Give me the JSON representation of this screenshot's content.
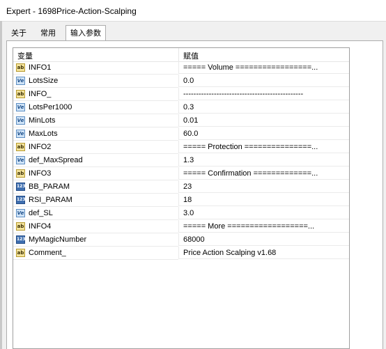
{
  "window": {
    "title": "Expert - 1698Price-Action-Scalping"
  },
  "tabs": [
    {
      "label": "关于"
    },
    {
      "label": "常用"
    },
    {
      "label": "输入参数"
    }
  ],
  "grid": {
    "headers": {
      "variable": "变量",
      "value": "赋值"
    },
    "rows": [
      {
        "icon": "ab",
        "name": "INFO1",
        "value": "===== Volume =================..."
      },
      {
        "icon": "ve",
        "name": "LotsSize",
        "value": "0.0"
      },
      {
        "icon": "ab",
        "name": "INFO_",
        "value": "-----------------------------------------------"
      },
      {
        "icon": "ve",
        "name": "LotsPer1000",
        "value": "0.3"
      },
      {
        "icon": "ve",
        "name": "MinLots",
        "value": "0.01"
      },
      {
        "icon": "ve",
        "name": "MaxLots",
        "value": "60.0"
      },
      {
        "icon": "ab",
        "name": "INFO2",
        "value": "===== Protection ===============..."
      },
      {
        "icon": "ve",
        "name": "def_MaxSpread",
        "value": "1.3"
      },
      {
        "icon": "ab",
        "name": "INFO3",
        "value": "===== Confirmation =============..."
      },
      {
        "icon": "123",
        "name": "BB_PARAM",
        "value": "23"
      },
      {
        "icon": "123",
        "name": "RSI_PARAM",
        "value": "18"
      },
      {
        "icon": "ve",
        "name": "def_SL",
        "value": "3.0"
      },
      {
        "icon": "ab",
        "name": "INFO4",
        "value": "===== More ==================..."
      },
      {
        "icon": "123",
        "name": "MyMagicNumber",
        "value": "68000"
      },
      {
        "icon": "ab",
        "name": "Comment_",
        "value": "Price Action Scalping v1.68"
      }
    ]
  },
  "icon_labels": {
    "ab": "ab",
    "ve": "Ve",
    "123": "123"
  }
}
